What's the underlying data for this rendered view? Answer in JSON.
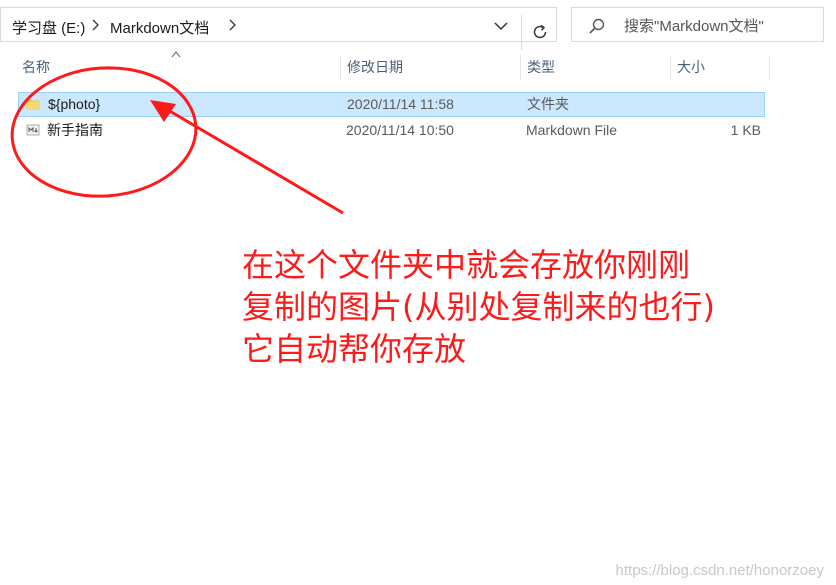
{
  "address": {
    "crumbs": [
      "学习盘 (E:)",
      "Markdown文档"
    ]
  },
  "search": {
    "placeholder": "搜索\"Markdown文档\""
  },
  "columns": {
    "name": "名称",
    "modified": "修改日期",
    "type": "类型",
    "size": "大小"
  },
  "files": [
    {
      "name": "${photo}",
      "modified": "2020/11/14 11:58",
      "type": "文件夹",
      "size": "",
      "icon": "folder-icon",
      "selected": true
    },
    {
      "name": "新手指南",
      "modified": "2020/11/14 10:50",
      "type": "Markdown File",
      "size": "1 KB",
      "icon": "markdown-file-icon",
      "selected": false
    }
  ],
  "annotation": {
    "lines": [
      "在这个文件夹中就会存放你刚刚",
      "复制的图片(从别处复制来的也行)",
      "它自动帮你存放"
    ],
    "color": "#ff1a1a"
  },
  "watermark": "https://blog.csdn.net/honorzoey",
  "colors": {
    "selection": "#cce8ff",
    "selection_border": "#99d1ff",
    "header_text": "#4c607a",
    "annotation": "#ff1a1a"
  }
}
